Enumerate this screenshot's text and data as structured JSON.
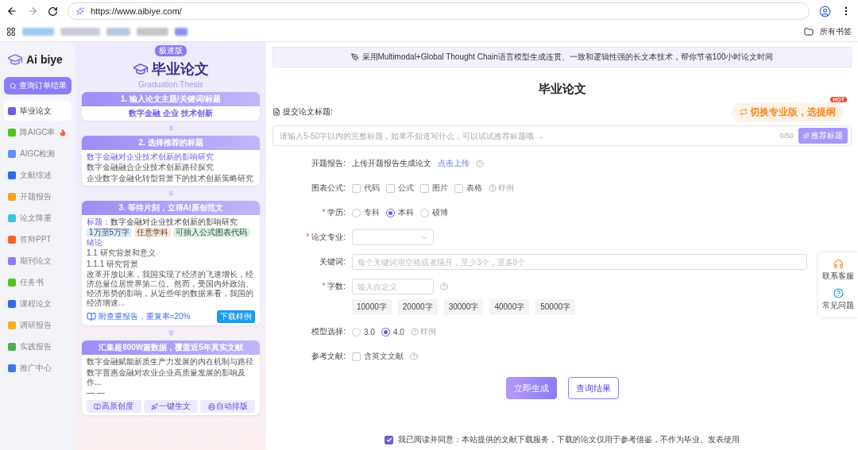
{
  "browser": {
    "url": "https://www.aibiye.com/",
    "bookmarks_folder": "所有书签"
  },
  "sidebar": {
    "logo": "Ai biye",
    "order_button": "查询订单结果",
    "items": [
      {
        "label": "毕业论文",
        "selected": true,
        "color": "#6b5ce7"
      },
      {
        "label": "降AIGC率",
        "selected": false,
        "color": "#52c41a",
        "hot": true
      },
      {
        "label": "AIGC检测",
        "selected": false,
        "color": "#5b8ff9"
      },
      {
        "label": "文献综述",
        "selected": false,
        "color": "#2f6bea"
      },
      {
        "label": "开题报告",
        "selected": false,
        "color": "#f5a623"
      },
      {
        "label": "论文降重",
        "selected": false,
        "color": "#36c5e0"
      },
      {
        "label": "答辩PPT",
        "selected": false,
        "color": "#f0642d"
      },
      {
        "label": "期刊论文",
        "selected": false,
        "color": "#8c7cf0"
      },
      {
        "label": "任务书",
        "selected": false,
        "color": "#52c41a"
      },
      {
        "label": "课程论文",
        "selected": false,
        "color": "#2f6bea"
      },
      {
        "label": "调研报告",
        "selected": false,
        "color": "#f5b323"
      },
      {
        "label": "实践报告",
        "selected": false,
        "color": "#4caf50"
      },
      {
        "label": "推广中心",
        "selected": false,
        "color": "#3a7bea"
      }
    ]
  },
  "promo": {
    "badge": "极速版",
    "title": "毕业论文",
    "subtitle": "Graduation Thesis",
    "step1": {
      "title": "1. 输入论文主题/关键词/标题",
      "keywords": "数字金融 企业 技术创新"
    },
    "step2": {
      "title": "2. 选择推荐的标题",
      "titles": [
        {
          "text": "数字金融对企业技术创新的影响研究",
          "selected": true
        },
        {
          "text": "数字金融融合企业技术创新路径探究",
          "selected": false
        },
        {
          "text": "企业数字金融化转型背景下的技术创新策略研究",
          "selected": false
        }
      ]
    },
    "step3": {
      "title": "3. 等待片刻，立得AI原创范文",
      "label": "标题：",
      "paper_title": "数字金融对企业技术创新的影响研究",
      "tags": [
        {
          "text": "1万至5万字",
          "color": "#dbeafe"
        },
        {
          "text": "任意学科",
          "color": "#fde8d4"
        },
        {
          "text": "可插入公式图表代码",
          "color": "#d7f2df"
        }
      ],
      "section": "绪论",
      "headings": [
        "1.1 研究背景和意义",
        "1.1.1 研究背景"
      ],
      "paragraph": "改革开放以来，我国实现了经济的飞速增长，经济总量位居世界第二位。然而，受国内外政治、经济形势的影响，从近些年的数据来看，我国的经济增速...",
      "report_text": "附查重报告，重复率≈20%",
      "download": "下载样例"
    },
    "step4": {
      "title": "汇集超800W篇数据，覆盖近5年真实文献",
      "refs": [
        "数字金融赋能新质生产力发展的内在机制与路径",
        "数字普惠金融对农业企业高质量发展的影响及作..."
      ],
      "more": "— —",
      "features": [
        "高原创度",
        "一键生文",
        "自动排版"
      ]
    }
  },
  "main": {
    "required_mark": "*",
    "banner": "采用Multimodal+Global Thought Chain语言模型生成连贯、一致和逻辑性强的长文本技术，帮你节省100小时论文时间",
    "title": "毕业论文",
    "title_label": "提交论文标题:",
    "pro_button": "切换专业版，选提纲",
    "pro_badge": "HOT",
    "title_placeholder": "请输入5-50字以内的完整标题，如果不知道写什么，可以试试推荐标题哦 →",
    "counter": "0/50",
    "recommend": "推荐标题",
    "rows": [
      {
        "kind": "upload",
        "label": "开题报告:",
        "required": false,
        "text": "上传开题报告生成论文",
        "link": "点击上传",
        "help": true
      },
      {
        "kind": "checkboxes",
        "label": "图表公式:",
        "required": false,
        "options": [
          {
            "label": "代码",
            "checked": false
          },
          {
            "label": "公式",
            "checked": false
          },
          {
            "label": "图片",
            "checked": false
          },
          {
            "label": "表格",
            "checked": false
          }
        ],
        "example": "样例"
      },
      {
        "kind": "radios",
        "label": "学历:",
        "required": true,
        "options": [
          {
            "label": "专科",
            "selected": false
          },
          {
            "label": "本科",
            "selected": true
          },
          {
            "label": "硕博",
            "selected": false
          }
        ]
      },
      {
        "kind": "select",
        "label": "论文专业:",
        "required": true
      },
      {
        "kind": "input",
        "label": "关键词:",
        "required": false,
        "placeholder": "每个关键词用空格或者隔开，至少3个，至多8个"
      },
      {
        "kind": "wordcount",
        "label": "字数:",
        "required": true,
        "placeholder": "输入自定义",
        "help": true,
        "presets": [
          "10000字",
          "20000字",
          "30000字",
          "40000字",
          "50000字"
        ]
      },
      {
        "kind": "radios",
        "label": "模型选择:",
        "required": false,
        "options": [
          {
            "label": "3.0",
            "selected": false
          },
          {
            "label": "4.0",
            "selected": true
          }
        ],
        "example": "样例"
      },
      {
        "kind": "checkboxes",
        "label": "参考文献:",
        "required": false,
        "options": [
          {
            "label": "含英文文献",
            "checked": false
          }
        ],
        "help": true
      }
    ],
    "generate": "立即生成",
    "query": "查询结果",
    "agreement": {
      "checked": true,
      "text": "我已阅读并同意：本站提供的文献下载服务，下载的论文仅用于参考借鉴，不作为毕业、发表使用"
    }
  },
  "float_panel": [
    "联系客服",
    "常见问题"
  ]
}
